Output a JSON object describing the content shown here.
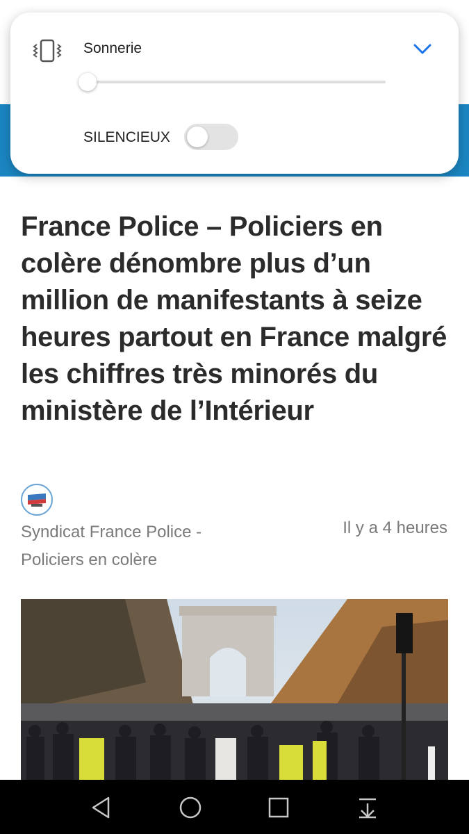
{
  "volume_panel": {
    "title": "Sonnerie",
    "ringer_level": 0,
    "silent_label": "SILENCIEUX",
    "silent_on": false,
    "icon": "vibrate-icon",
    "expand_icon": "chevron-down-icon",
    "accent_color": "#1a73e8"
  },
  "article": {
    "headline": "France Police – Policiers en colère dénombre plus d’un million de manifestants à seize heures partout en France malgré les chiffres très minorés du ministère de l’Intérieur",
    "source_name": "Syndicat France Police - Policiers en colère",
    "timestamp": "Il y a 4 heures",
    "header_color": "#1b86c2"
  },
  "nav_bar": {
    "back_icon": "back-triangle-icon",
    "home_icon": "home-circle-icon",
    "recents_icon": "recents-square-icon",
    "notifications_icon": "pull-down-icon"
  }
}
